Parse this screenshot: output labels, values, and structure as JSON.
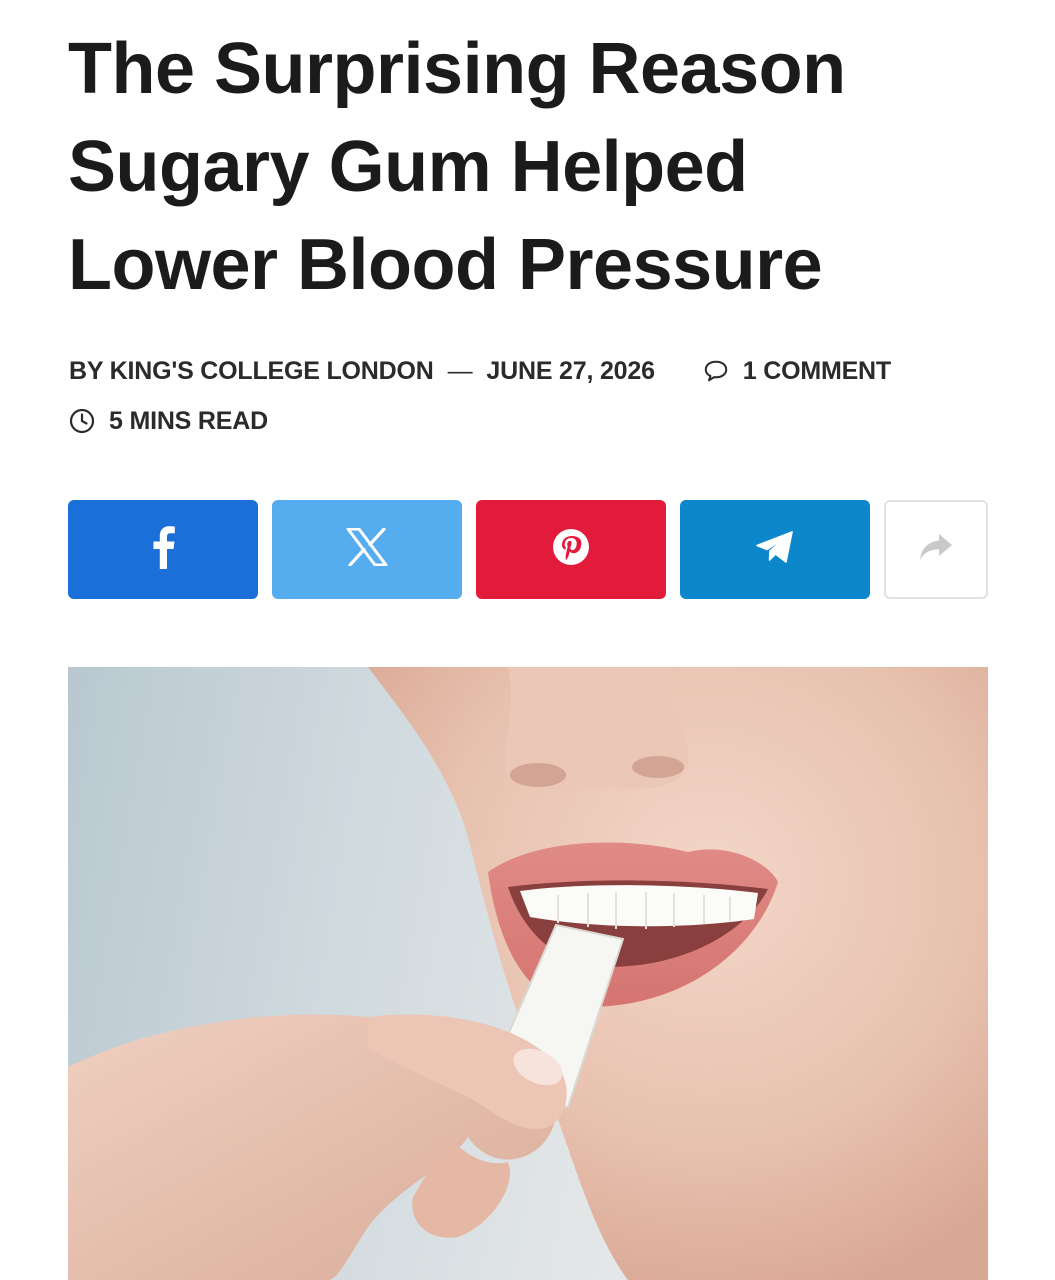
{
  "article": {
    "title": "The Surprising Reason Sugary Gum Helped Lower Blood Pressure",
    "byline": "BY KING'S COLLEGE LONDON",
    "separator": "—",
    "date": "JUNE 27, 2026",
    "comments": "1 COMMENT",
    "read_time": "5 MINS READ"
  },
  "share": {
    "facebook": {
      "icon": "facebook-icon",
      "color": "#1b6fd8"
    },
    "x": {
      "icon": "x-icon",
      "color": "#55acee"
    },
    "pinterest": {
      "icon": "pinterest-icon",
      "color": "#e31b3a"
    },
    "telegram": {
      "icon": "telegram-icon",
      "color": "#0d87cb"
    },
    "more": {
      "icon": "share-arrow-icon"
    }
  },
  "hero_image": {
    "subject": "woman biting a stick of chewing gum"
  }
}
